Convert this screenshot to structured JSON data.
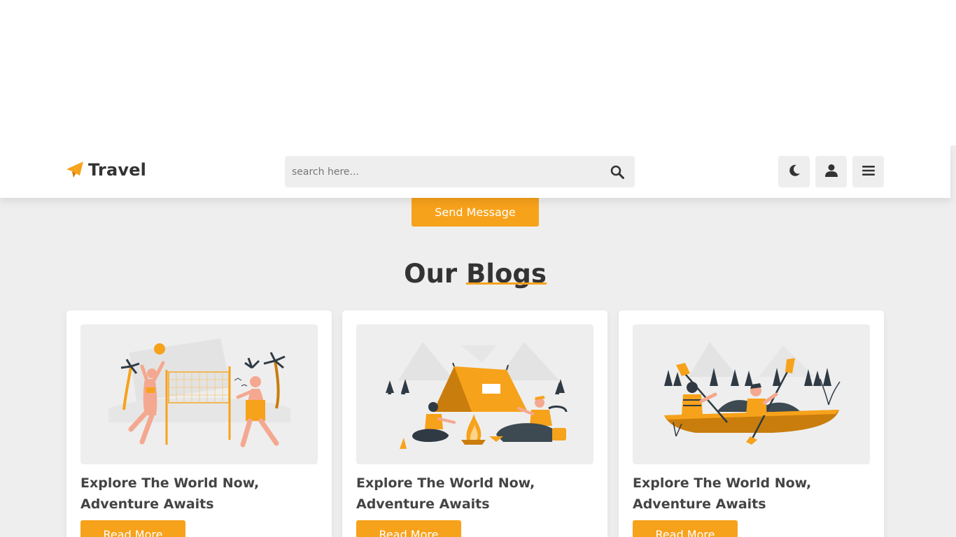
{
  "header": {
    "logo_text": "Travel",
    "search_placeholder": "search here...",
    "icons": [
      "paper-plane-icon",
      "search-icon",
      "moon-icon",
      "user-icon",
      "menu-icon"
    ]
  },
  "contact": {
    "send_label": "Send Message"
  },
  "blogs": {
    "title_part1": "Our",
    "title_part2": "Blogs",
    "cards": [
      {
        "title": "Explore The World Now, Adventure Awaits",
        "button": "Read More"
      },
      {
        "title": "Explore The World Now, Adventure Awaits",
        "button": "Read More"
      },
      {
        "title": "Explore The World Now, Adventure Awaits",
        "button": "Read More"
      }
    ]
  },
  "colors": {
    "accent": "#f7a21b",
    "background": "#eeeeee",
    "text": "#333333"
  }
}
